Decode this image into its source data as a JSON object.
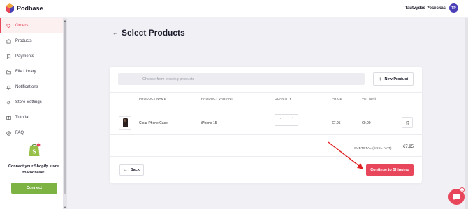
{
  "app": {
    "name": "Podbase"
  },
  "user": {
    "name": "Tautvydas Peseckas",
    "initials": "TP"
  },
  "sidebar": {
    "items": [
      {
        "label": "Orders",
        "icon": "tag-icon",
        "active": true
      },
      {
        "label": "Products",
        "icon": "box-icon",
        "active": false
      },
      {
        "label": "Payments",
        "icon": "payments-icon",
        "active": false
      },
      {
        "label": "File Library",
        "icon": "folder-icon",
        "active": false
      },
      {
        "label": "Notifications",
        "icon": "bell-icon",
        "active": false
      },
      {
        "label": "Store Settings",
        "icon": "gear-icon",
        "active": false
      },
      {
        "label": "Tutorial",
        "icon": "book-icon",
        "active": false
      },
      {
        "label": "FAQ",
        "icon": "question-icon",
        "active": false
      }
    ],
    "promo": {
      "text": "Connect your Shopify store to Podbase!",
      "button": "Connect"
    }
  },
  "page": {
    "title": "Select Products"
  },
  "search": {
    "placeholder": "Choose from existing products"
  },
  "new_product_label": "New Product",
  "table": {
    "headers": [
      "PRODUCT NAME",
      "PRODUCT VARIANT",
      "QUANTITY",
      "PRICE",
      "VAT (0%)"
    ],
    "rows": [
      {
        "name": "Clear Phone Case",
        "variant": "iPhone 15",
        "quantity": "1",
        "price": "€7.95",
        "vat": "€0.00"
      }
    ]
  },
  "subtotal": {
    "label": "SUBTOTAL (EXCL. VAT)",
    "value": "€7.95"
  },
  "back_label": "Back",
  "continue_label": "Continue to Shipping",
  "chat": {
    "badge": "1"
  },
  "colors": {
    "accent": "#e8475b",
    "brand": "#4b3fb8",
    "connect": "#7cb342"
  }
}
